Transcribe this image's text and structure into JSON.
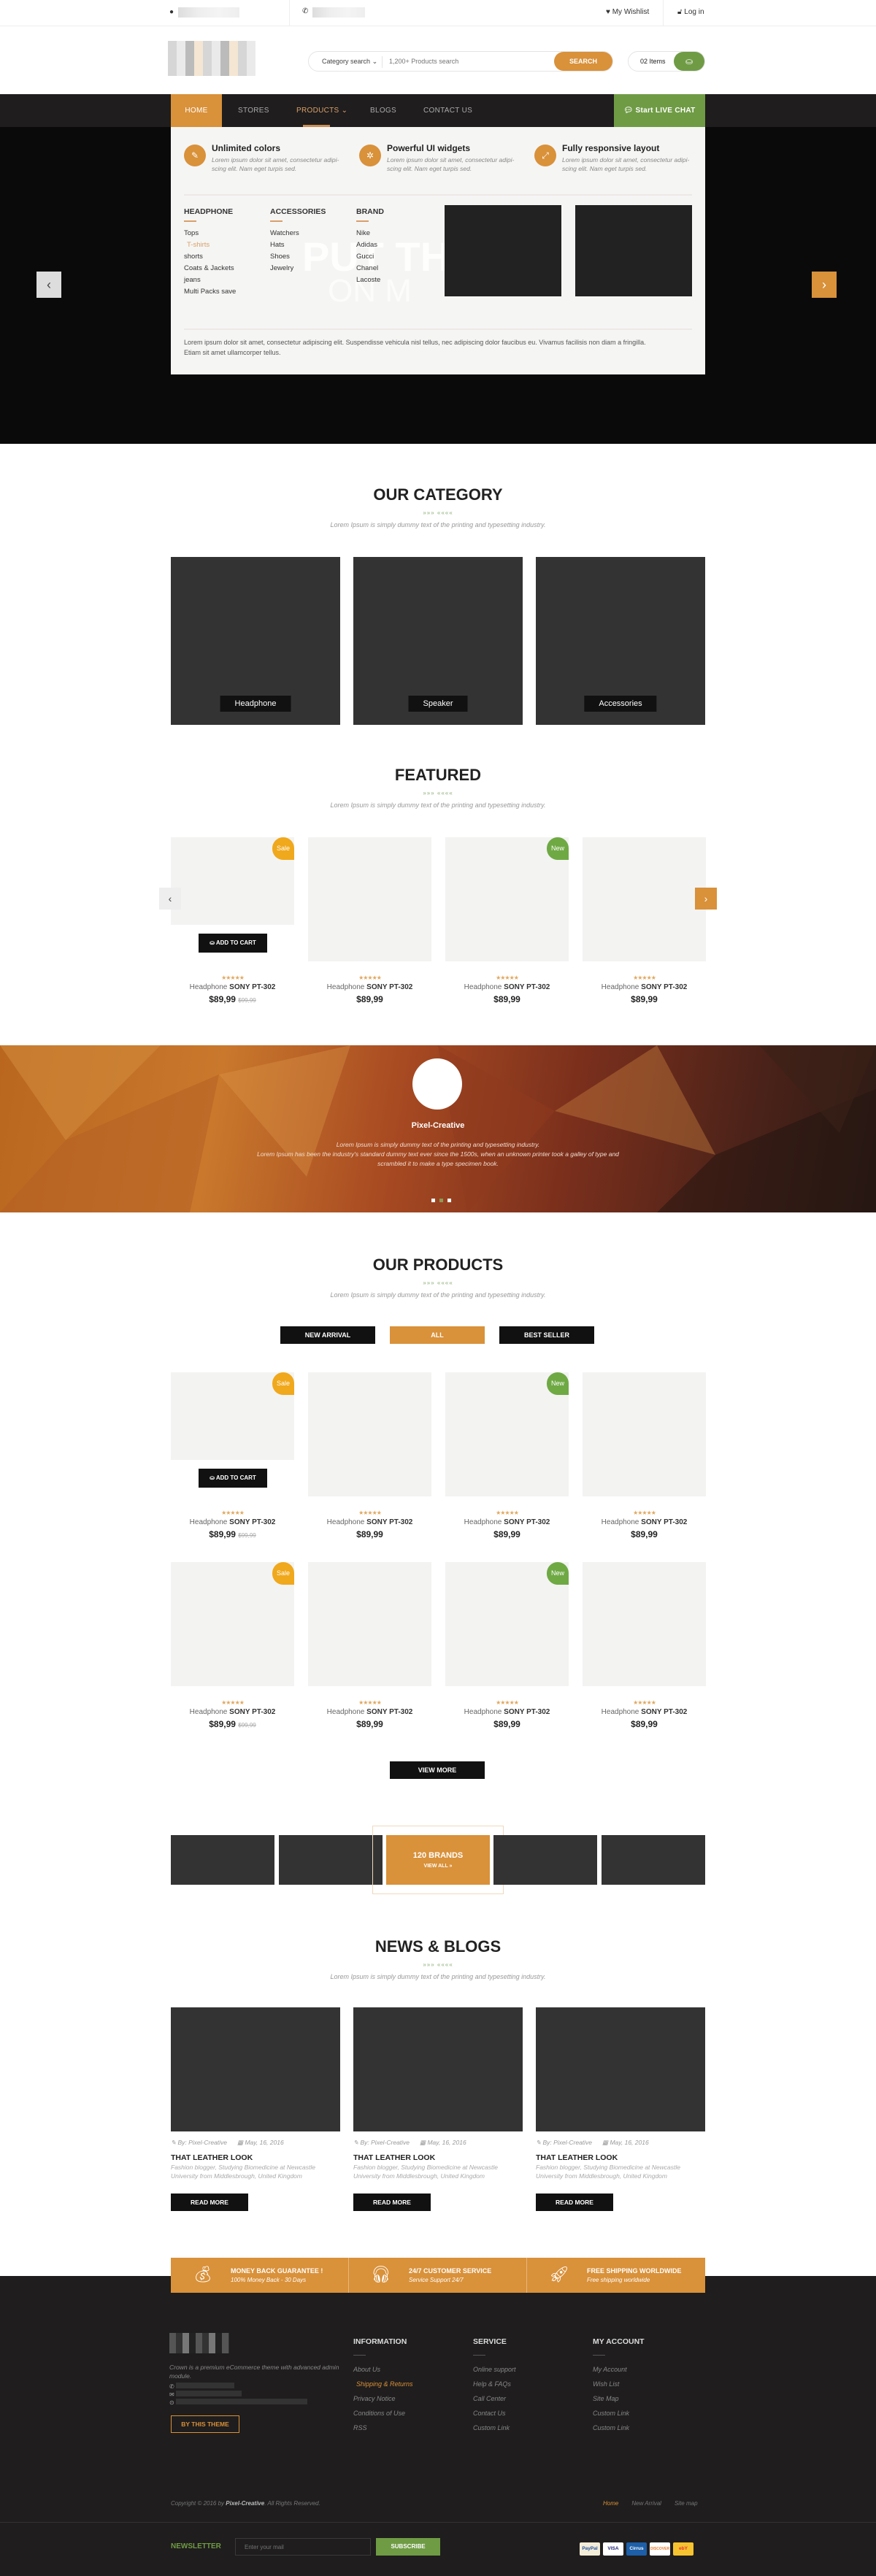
{
  "colors": {
    "accent": "#d9913a",
    "green": "#6f9b45",
    "dark": "#1f1d1d"
  },
  "topbar": {
    "wishlist": "My Wishlist",
    "login": "Log in"
  },
  "header": {
    "category_search": "Category search",
    "search_placeholder": "1,200+ Products search",
    "search_button": "SEARCH",
    "cart_items": "02 Items"
  },
  "nav": {
    "items": [
      "HOME",
      "STORES",
      "PRODUCTS",
      "BLOGS",
      "CONTACT US"
    ],
    "active": "HOME",
    "open": "PRODUCTS",
    "live_chat": "Start LIVE CHAT"
  },
  "mega": {
    "features": [
      {
        "icon": "eyedropper-icon",
        "title": "Unlimited colors",
        "desc": "Lorem ipsum dolor sit amet, consectetur adipi-scing elit. Nam eget turpis sed."
      },
      {
        "icon": "gear-icon",
        "title": "Powerful UI widgets",
        "desc": "Lorem ipsum dolor sit amet, consectetur adipi-scing elit. Nam eget turpis sed."
      },
      {
        "icon": "expand-icon",
        "title": "Fully responsive layout",
        "desc": "Lorem ipsum dolor sit amet, consectetur adipi-scing elit. Nam eget turpis sed."
      }
    ],
    "columns": [
      {
        "title": "HEADPHONE",
        "items": [
          "Tops",
          "T-shirts",
          "shorts",
          "Coats & Jackets",
          "jeans",
          "Multi Packs save"
        ]
      },
      {
        "title": "ACCESSORIES",
        "items": [
          "Watchers",
          "Hats",
          "Shoes",
          "Jewelry"
        ]
      },
      {
        "title": "BRAND",
        "items": [
          "Nike",
          "Adidas",
          "Gucci",
          "Chanel",
          "Lacoste"
        ]
      }
    ],
    "highlighted_item": "T-shirts",
    "footer_text": "Lorem ipsum dolor sit amet, consectetur adipiscing elit. Suspendisse vehicula nisl tellus, nec adipiscing dolor faucibus eu. Vivamus facilisis non diam a fringilla. Etiam sit amet ullamcorper tellus.",
    "hero_bg_text": "PUT THE",
    "hero_bg_text2": "ON M"
  },
  "category": {
    "title": "OUR CATEGORY",
    "ornament": "»»»   ««««",
    "subtitle": "Lorem Ipsum is simply dummy text of the printing and typesetting industry.",
    "cards": [
      "Headphone",
      "Speaker",
      "Accessories"
    ]
  },
  "featured": {
    "title": "FEATURED",
    "ornament": "»»»   ««««",
    "subtitle": "Lorem Ipsum is simply dummy text of the printing and typesetting industry.",
    "add_to_cart": "ADD TO CART",
    "products": [
      {
        "brand": "Headphone",
        "model": "SONY PT-302",
        "price": "$89,99",
        "old_price": "$99,99",
        "badge": "Sale",
        "rating": 5
      },
      {
        "brand": "Headphone",
        "model": "SONY PT-302",
        "price": "$89,99",
        "rating": 5
      },
      {
        "brand": "Headphone",
        "model": "SONY PT-302",
        "price": "$89,99",
        "badge": "New",
        "rating": 5
      },
      {
        "brand": "Headphone",
        "model": "SONY PT-302",
        "price": "$89,99",
        "rating": 5
      }
    ]
  },
  "testimonial": {
    "name": "Pixel-Creative",
    "quote_line1": "Lorem Ipsum is simply dummy text of the printing and typesetting industry.",
    "quote_line2": "Lorem Ipsum has been the industry's standard dummy text ever since the 1500s, when an unknown printer took a galley of type and scrambled it to make a type specimen book.",
    "dots": 3,
    "active_dot": 2
  },
  "products": {
    "title": "OUR PRODUCTS",
    "ornament": "»»»   ««««",
    "subtitle": "Lorem Ipsum is simply dummy text of the printing and typesetting industry.",
    "tabs": [
      "NEW ARRIVAL",
      "ALL",
      "BEST SELLER"
    ],
    "active_tab": "ALL",
    "add_to_cart": "ADD TO CART",
    "items": [
      {
        "brand": "Headphone",
        "model": "SONY PT-302",
        "price": "$89,99",
        "old_price": "$99,99",
        "badge": "Sale",
        "rating": 5
      },
      {
        "brand": "Headphone",
        "model": "SONY PT-302",
        "price": "$89,99",
        "rating": 5
      },
      {
        "brand": "Headphone",
        "model": "SONY PT-302",
        "price": "$89,99",
        "badge": "New",
        "rating": 5
      },
      {
        "brand": "Headphone",
        "model": "SONY PT-302",
        "price": "$89,99",
        "rating": 5
      },
      {
        "brand": "Headphone",
        "model": "SONY PT-302",
        "price": "$89,99",
        "old_price": "$99,99",
        "badge": "Sale",
        "rating": 5
      },
      {
        "brand": "Headphone",
        "model": "SONY PT-302",
        "price": "$89,99",
        "rating": 5
      },
      {
        "brand": "Headphone",
        "model": "SONY PT-302",
        "price": "$89,99",
        "badge": "New",
        "rating": 5
      },
      {
        "brand": "Headphone",
        "model": "SONY PT-302",
        "price": "$89,99",
        "rating": 5
      }
    ],
    "view_more": "VIEW MORE"
  },
  "brands": {
    "count_label": "120 BRANDS",
    "view_all": "VIEW ALL »"
  },
  "news": {
    "title": "NEWS & BLOGS",
    "ornament": "»»»   ««««",
    "subtitle": "Lorem Ipsum is simply dummy text of the printing and typesetting industry.",
    "posts": [
      {
        "author": "By: Pixel-Creative",
        "date": "May, 16, 2016",
        "title": "THAT LEATHER LOOK",
        "desc": "Fashion blogger, Studying Biomedicine at Newcastle University from Middlesbrough, United Kingdom",
        "button": "READ MORE"
      },
      {
        "author": "By: Pixel-Creative",
        "date": "May, 16, 2016",
        "title": "THAT LEATHER LOOK",
        "desc": "Fashion blogger, Studying Biomedicine at Newcastle University from Middlesbrough, United Kingdom",
        "button": "READ MORE"
      },
      {
        "author": "By: Pixel-Creative",
        "date": "May, 16, 2016",
        "title": "THAT LEATHER LOOK",
        "desc": "Fashion blogger, Studying Biomedicine at Newcastle University from Middlesbrough, United Kingdom",
        "button": "READ MORE"
      }
    ]
  },
  "services": [
    {
      "icon": "money-bag-icon",
      "title": "MONEY BACK GUARANTEE !",
      "sub": "100% Money Back - 30 Days"
    },
    {
      "icon": "headset-icon",
      "title": "24/7 CUSTOMER SERVICE",
      "sub": "Service Support 24/7"
    },
    {
      "icon": "rocket-icon",
      "title": "FREE SHIPPING WORLDWIDE",
      "sub": "Free shipping worldwide"
    }
  ],
  "footer": {
    "about": "Crown is a premium eCommerce theme with advanced admin module.",
    "buy_button": "BY THIS THEME",
    "columns": [
      {
        "title": "INFORMATION",
        "items": [
          "About Us",
          "Shipping & Returns",
          "Privacy Notice",
          "Conditions of Use",
          "RSS"
        ]
      },
      {
        "title": "SERVICE",
        "items": [
          "Online support",
          "Help & FAQs",
          "Call Center",
          "Contact Us",
          "Custom Link"
        ]
      },
      {
        "title": "MY ACCOUNT",
        "items": [
          "My Account",
          "Wish List",
          "Site Map",
          "Custom Link",
          "Custom Link"
        ]
      }
    ],
    "highlighted": "Shipping & Returns",
    "copyright_pre": "Copyright © 2016 by ",
    "copyright_brand": "Pixel-Creative",
    "copyright_post": ". All Rights Reserved.",
    "bottom_links": [
      "Home",
      "New Arrival",
      "Site map"
    ],
    "newsletter_label": "NEWSLETTER",
    "newsletter_placeholder": "Enter your mail",
    "subscribe": "SUBSCRIBE",
    "payments": [
      "PayPal",
      "VISA",
      "Cirrus",
      "DISCOVER",
      "ebY"
    ]
  }
}
